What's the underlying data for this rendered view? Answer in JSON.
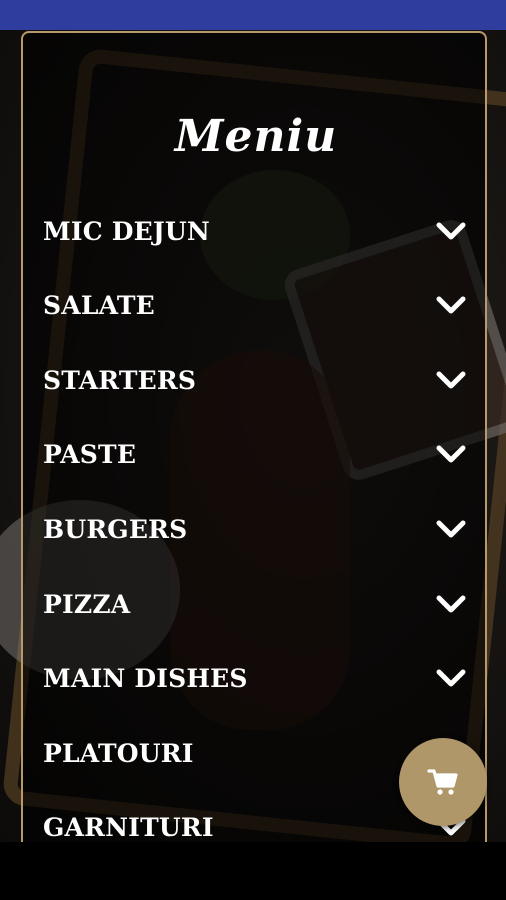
{
  "menu": {
    "title": "Meniu",
    "items": [
      {
        "label": "MIC DEJUN",
        "has_chevron": true
      },
      {
        "label": "SALATE",
        "has_chevron": true
      },
      {
        "label": "STARTERS",
        "has_chevron": true
      },
      {
        "label": "PASTE",
        "has_chevron": true
      },
      {
        "label": "BURGERS",
        "has_chevron": true
      },
      {
        "label": "PIZZA",
        "has_chevron": true
      },
      {
        "label": "MAIN DISHES",
        "has_chevron": true
      },
      {
        "label": "PLATOURI",
        "has_chevron": false
      },
      {
        "label": "GARNITURI",
        "has_chevron": true
      }
    ]
  },
  "cart_button": {
    "icon": "cart-icon"
  },
  "colors": {
    "status_bar": "#2f3d9e",
    "panel_border": "#b8996a",
    "cart_button": "#b0976a",
    "text": "#ffffff"
  }
}
